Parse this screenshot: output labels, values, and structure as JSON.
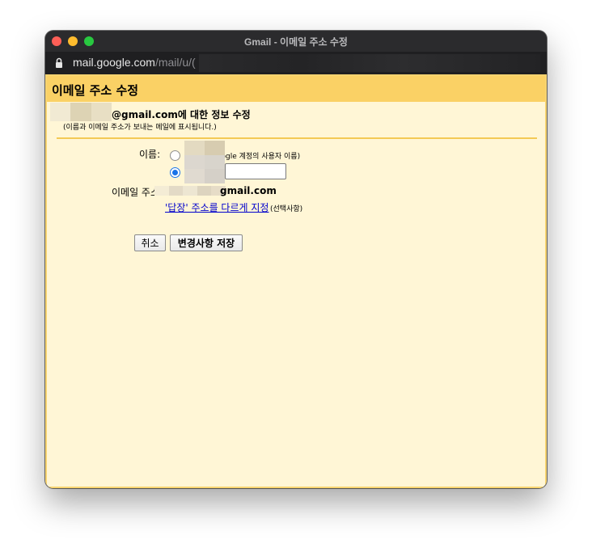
{
  "window": {
    "title": "Gmail - 이메일 주소 수정",
    "url_host": "mail.google.com",
    "url_path": "/mail/u/("
  },
  "page": {
    "title": "이메일 주소 수정",
    "account_line": "@gmail.com에 대한 정보 수정",
    "account_sub": "(이름과 이메일 주소가 보내는 메일에 표시됩니다.)"
  },
  "form": {
    "name_label": "이름:",
    "google_option_label": "oogle 계정의 사용자 이름)",
    "name_input_value": "",
    "email_label": "이메일 주소",
    "email_value": "gmail.com",
    "reply_link": "'답장' 주소를 다르게 지정",
    "optional_note": "(선택사항)"
  },
  "buttons": {
    "cancel": "취소",
    "save": "변경사항 저장"
  },
  "colors": {
    "header": "#fad165",
    "background": "#fff6d6",
    "link": "#0000cc",
    "radio_selected": "#1a73e8"
  },
  "icons": {
    "lock": "lock-icon"
  }
}
